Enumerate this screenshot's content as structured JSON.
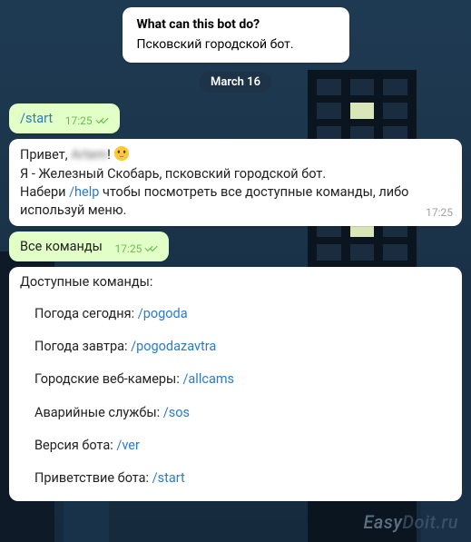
{
  "info": {
    "title": "What can this bot do?",
    "desc": "Псковский городской бот."
  },
  "date_badge": "March 16",
  "msg1": {
    "command": "/start",
    "time": "17:25"
  },
  "msg2": {
    "greeting_prefix": "Привет, ",
    "username_blurred": "Artem",
    "greeting_suffix": "! ",
    "line2_a": "Я - Железный Скобарь, псковский городской бот.",
    "line3_a": "Набери ",
    "help_cmd": "/help",
    "line3_b": " чтобы посмотреть все доступные команды, либо используй меню.",
    "time": "17:25"
  },
  "msg3": {
    "text": "Все команды",
    "time": "17:25"
  },
  "msg4": {
    "header": "Доступные команды:",
    "items": [
      {
        "label": "Погода сегодня: ",
        "cmd": "/pogoda"
      },
      {
        "label": "Погода завтра: ",
        "cmd": "/pogodazavtra"
      },
      {
        "label": "Городские веб-камеры: ",
        "cmd": "/allcams"
      },
      {
        "label": "Аварийные службы: ",
        "cmd": "/sos"
      },
      {
        "label": "Версия бота: ",
        "cmd": "/ver"
      },
      {
        "label": "Приветствие бота: ",
        "cmd": "/start"
      }
    ]
  },
  "watermark": {
    "a": "Easy",
    "b": "Doit.ru"
  }
}
